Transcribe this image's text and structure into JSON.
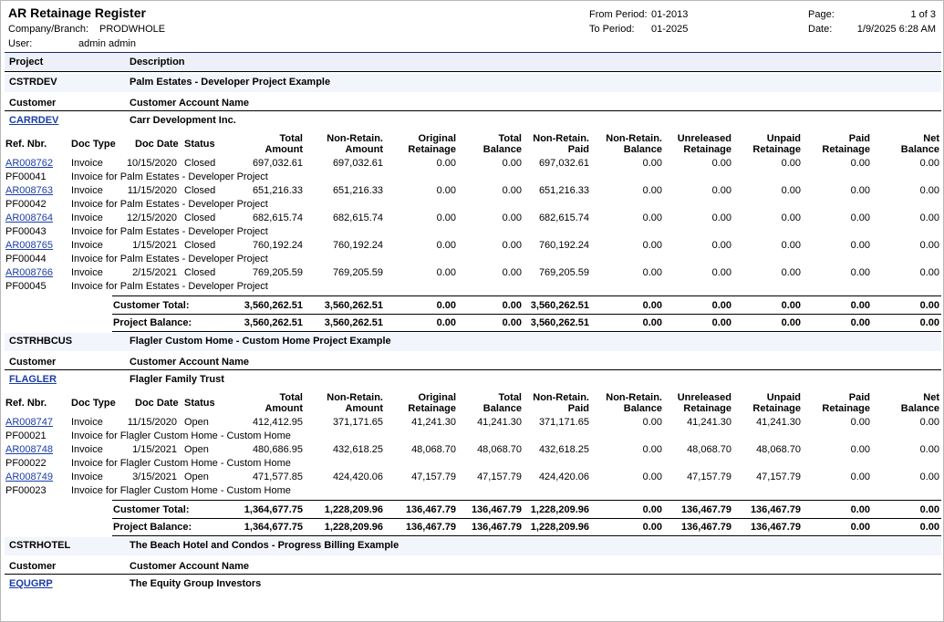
{
  "report": {
    "title": "AR Retainage Register",
    "company_label": "Company/Branch:",
    "company": "PRODWHOLE",
    "user_label": "User:",
    "user": "admin admin",
    "from_label": "From Period:",
    "from": "01-2013",
    "to_label": "To Period:",
    "to": "01-2025",
    "page_label": "Page:",
    "page": "1 of 3",
    "date_label": "Date:",
    "date": "1/9/2025 6:28 AM"
  },
  "labels": {
    "project": "Project",
    "description": "Description",
    "customer": "Customer",
    "customer_account_name": "Customer Account Name",
    "customer_total": "Customer Total:",
    "project_balance": "Project Balance:"
  },
  "columns": [
    [
      "Ref. Nbr."
    ],
    [
      "Doc Type"
    ],
    [
      "Doc Date"
    ],
    [
      "Status"
    ],
    [
      "Total",
      "Amount"
    ],
    [
      "Non-Retain.",
      "Amount"
    ],
    [
      "Original",
      "Retainage"
    ],
    [
      "Total",
      "Balance"
    ],
    [
      "Non-Retain.",
      "Paid"
    ],
    [
      "Non-Retain.",
      "Balance"
    ],
    [
      "Unreleased",
      "Retainage"
    ],
    [
      "Unpaid",
      "Retainage"
    ],
    [
      "Paid",
      "Retainage"
    ],
    [
      "Net",
      "Balance"
    ]
  ],
  "projects": [
    {
      "code": "CSTRDEV",
      "description": "Palm Estates - Developer Project Example",
      "customer": "CARRDEV",
      "customer_name": "Carr Development Inc.",
      "docs": [
        {
          "ref": "AR008762",
          "type": "Invoice",
          "date": "10/15/2020",
          "status": "Closed",
          "vals": [
            "697,032.61",
            "697,032.61",
            "0.00",
            "0.00",
            "697,032.61",
            "0.00",
            "0.00",
            "0.00",
            "0.00",
            "0.00"
          ],
          "po": "PF00041",
          "desc": "Invoice for Palm Estates - Developer Project"
        },
        {
          "ref": "AR008763",
          "type": "Invoice",
          "date": "11/15/2020",
          "status": "Closed",
          "vals": [
            "651,216.33",
            "651,216.33",
            "0.00",
            "0.00",
            "651,216.33",
            "0.00",
            "0.00",
            "0.00",
            "0.00",
            "0.00"
          ],
          "po": "PF00042",
          "desc": "Invoice for Palm Estates - Developer Project"
        },
        {
          "ref": "AR008764",
          "type": "Invoice",
          "date": "12/15/2020",
          "status": "Closed",
          "vals": [
            "682,615.74",
            "682,615.74",
            "0.00",
            "0.00",
            "682,615.74",
            "0.00",
            "0.00",
            "0.00",
            "0.00",
            "0.00"
          ],
          "po": "PF00043",
          "desc": "Invoice for Palm Estates - Developer Project"
        },
        {
          "ref": "AR008765",
          "type": "Invoice",
          "date": "1/15/2021",
          "status": "Closed",
          "vals": [
            "760,192.24",
            "760,192.24",
            "0.00",
            "0.00",
            "760,192.24",
            "0.00",
            "0.00",
            "0.00",
            "0.00",
            "0.00"
          ],
          "po": "PF00044",
          "desc": "Invoice for Palm Estates - Developer Project"
        },
        {
          "ref": "AR008766",
          "type": "Invoice",
          "date": "2/15/2021",
          "status": "Closed",
          "vals": [
            "769,205.59",
            "769,205.59",
            "0.00",
            "0.00",
            "769,205.59",
            "0.00",
            "0.00",
            "0.00",
            "0.00",
            "0.00"
          ],
          "po": "PF00045",
          "desc": "Invoice for Palm Estates - Developer Project"
        }
      ],
      "customer_total": [
        "3,560,262.51",
        "3,560,262.51",
        "0.00",
        "0.00",
        "3,560,262.51",
        "0.00",
        "0.00",
        "0.00",
        "0.00",
        "0.00"
      ],
      "project_balance": [
        "3,560,262.51",
        "3,560,262.51",
        "0.00",
        "0.00",
        "3,560,262.51",
        "0.00",
        "0.00",
        "0.00",
        "0.00",
        "0.00"
      ]
    },
    {
      "code": "CSTRHBCUS",
      "description": "Flagler Custom Home - Custom Home Project Example",
      "customer": "FLAGLER",
      "customer_name": "Flagler Family Trust",
      "docs": [
        {
          "ref": "AR008747",
          "type": "Invoice",
          "date": "11/15/2020",
          "status": "Open",
          "vals": [
            "412,412.95",
            "371,171.65",
            "41,241.30",
            "41,241.30",
            "371,171.65",
            "0.00",
            "41,241.30",
            "41,241.30",
            "0.00",
            "0.00"
          ],
          "po": "PF00021",
          "desc": "Invoice for Flagler Custom Home - Custom Home"
        },
        {
          "ref": "AR008748",
          "type": "Invoice",
          "date": "1/15/2021",
          "status": "Open",
          "vals": [
            "480,686.95",
            "432,618.25",
            "48,068.70",
            "48,068.70",
            "432,618.25",
            "0.00",
            "48,068.70",
            "48,068.70",
            "0.00",
            "0.00"
          ],
          "po": "PF00022",
          "desc": "Invoice for Flagler Custom Home - Custom Home"
        },
        {
          "ref": "AR008749",
          "type": "Invoice",
          "date": "3/15/2021",
          "status": "Open",
          "vals": [
            "471,577.85",
            "424,420.06",
            "47,157.79",
            "47,157.79",
            "424,420.06",
            "0.00",
            "47,157.79",
            "47,157.79",
            "0.00",
            "0.00"
          ],
          "po": "PF00023",
          "desc": "Invoice for Flagler Custom Home - Custom Home"
        }
      ],
      "customer_total": [
        "1,364,677.75",
        "1,228,209.96",
        "136,467.79",
        "136,467.79",
        "1,228,209.96",
        "0.00",
        "136,467.79",
        "136,467.79",
        "0.00",
        "0.00"
      ],
      "project_balance": [
        "1,364,677.75",
        "1,228,209.96",
        "136,467.79",
        "136,467.79",
        "1,228,209.96",
        "0.00",
        "136,467.79",
        "136,467.79",
        "0.00",
        "0.00"
      ]
    },
    {
      "code": "CSTRHOTEL",
      "description": "The Beach Hotel and Condos - Progress Billing Example",
      "customer": "EQUGRP",
      "customer_name": "The Equity Group Investors",
      "docs": [],
      "customer_total": null,
      "project_balance": null
    }
  ]
}
